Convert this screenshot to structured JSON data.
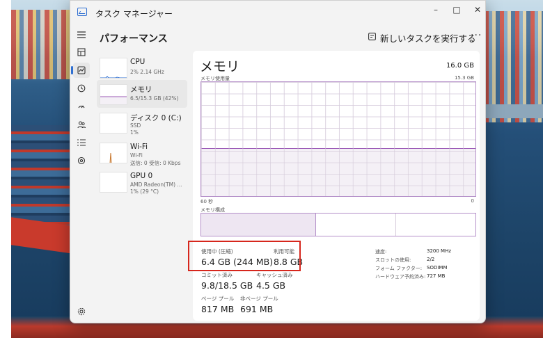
{
  "window": {
    "title": "タスク マネージャー",
    "controls": {
      "minimize": "–",
      "maximize": "□",
      "close": "✕"
    }
  },
  "nav_icons": [
    "hamburger-icon",
    "processes-icon",
    "performance-icon",
    "app-history-icon",
    "startup-icon",
    "users-icon",
    "details-icon",
    "services-icon",
    "settings-icon"
  ],
  "header": {
    "page_title": "パフォーマンス",
    "run_task_label": "新しいタスクを実行する",
    "more_label": "···"
  },
  "list": [
    {
      "name": "CPU",
      "sub1": "2% 2.14 GHz"
    },
    {
      "name": "メモリ",
      "sub1": "6.5/15.3 GB (42%)"
    },
    {
      "name": "ディスク 0 (C:)",
      "sub1": "SSD",
      "sub2": "1%"
    },
    {
      "name": "Wi-Fi",
      "sub1": "Wi-Fi",
      "sub2": "送信: 0 受信: 0 Kbps"
    },
    {
      "name": "GPU 0",
      "sub1": "AMD Radeon(TM) ...",
      "sub2": "1% (29 °C)"
    }
  ],
  "memory": {
    "title": "メモリ",
    "total": "16.0 GB",
    "usage_label": "メモリ使用量",
    "usage_max": "15.3 GB",
    "usage_fraction": 0.42,
    "axis_left": "60 秒",
    "axis_right": "0",
    "composition_label": "メモリ構成",
    "composition": {
      "in_use_fraction": 0.42,
      "standby_fraction": 0.29
    },
    "stats": {
      "in_use_label": "使用中 (圧縮)",
      "in_use_value": "6.4 GB (244 MB)",
      "available_label": "利用可能",
      "available_value": "8.8 GB",
      "committed_label": "コミット済み",
      "committed_value": "9.8/18.5 GB",
      "cached_label": "キャッシュ済み",
      "cached_value": "4.5 GB",
      "paged_label": "ページ プール",
      "paged_value": "817 MB",
      "nonpaged_label": "非ページ プール",
      "nonpaged_value": "691 MB"
    },
    "details": [
      {
        "key": "速度:",
        "value": "3200 MHz"
      },
      {
        "key": "スロットの使用:",
        "value": "2/2"
      },
      {
        "key": "フォーム ファクター:",
        "value": "SODIMM"
      },
      {
        "key": "ハードウェア予約済み:",
        "value": "727 MB"
      }
    ]
  },
  "colors": {
    "accent": "#2f6fd1",
    "memory_purple": "#9b59b6",
    "highlight_red": "#d6261c"
  }
}
